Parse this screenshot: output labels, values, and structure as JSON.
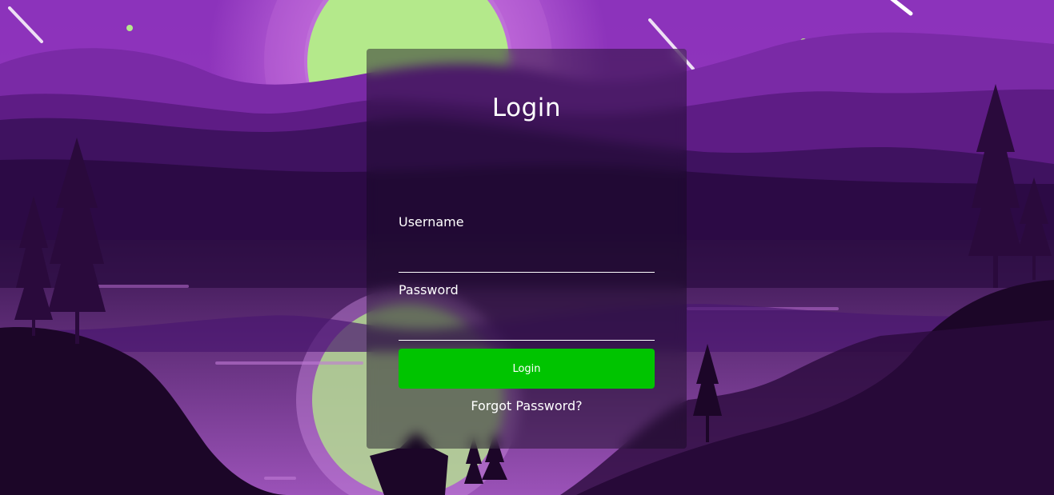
{
  "login_form": {
    "title": "Login",
    "username_label": "Username",
    "username_value": "",
    "password_label": "Password",
    "password_value": "",
    "submit_label": "Login",
    "forgot_label": "Forgot Password?"
  },
  "colors": {
    "sky": "#9a3fc0",
    "moon": "#b4e98b",
    "button": "#00c400",
    "text": "#ffffff"
  },
  "icons": [
    "shooting-star",
    "moon",
    "pine-tree"
  ]
}
